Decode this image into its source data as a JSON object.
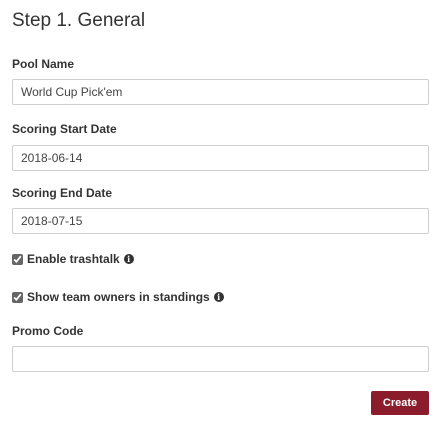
{
  "step": {
    "title": "Step 1. General"
  },
  "fields": {
    "pool_name": {
      "label": "Pool Name",
      "value": "World Cup Pick'em"
    },
    "scoring_start_date": {
      "label": "Scoring Start Date",
      "value": "2018-06-14"
    },
    "scoring_end_date": {
      "label": "Scoring End Date",
      "value": "2018-07-15"
    },
    "enable_trashtalk": {
      "label": "Enable trashtalk",
      "checked": true,
      "icon": "info-icon"
    },
    "show_team_owners": {
      "label": "Show team owners in standings",
      "checked": true,
      "icon": "info-icon"
    },
    "promo_code": {
      "label": "Promo Code",
      "value": ""
    }
  },
  "actions": {
    "create_label": "Create"
  },
  "colors": {
    "primary_button": "#8a1c2c",
    "text": "#333333",
    "input_border": "#cfcfcf"
  }
}
